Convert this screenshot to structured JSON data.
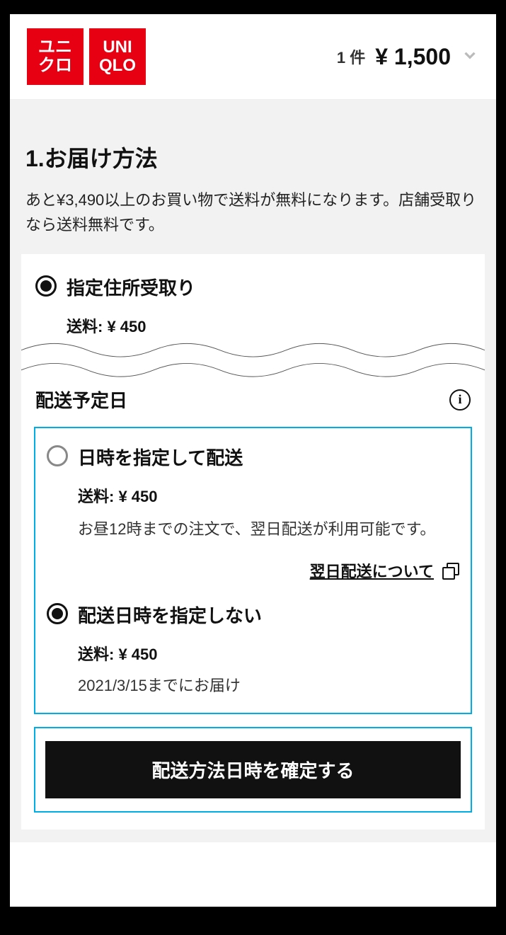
{
  "header": {
    "logo_jp_line1": "ユニ",
    "logo_jp_line2": "クロ",
    "logo_en_line1": "UNI",
    "logo_en_line2": "QLO",
    "cart_count": "1 件",
    "cart_price": "¥ 1,500"
  },
  "page": {
    "title": "1.お届け方法",
    "subtitle": "あと¥3,490以上のお買い物で送料が無料になります。店舗受取りなら送料無料です。"
  },
  "delivery_method": {
    "option1": {
      "title": "指定住所受取り",
      "shipping": "送料: ¥ 450"
    }
  },
  "schedule": {
    "section_title": "配送予定日",
    "option_scheduled": {
      "title": "日時を指定して配送",
      "shipping": "送料: ¥ 450",
      "desc": "お昼12時までの注文で、翌日配送が利用可能です。",
      "link": "翌日配送について"
    },
    "option_unscheduled": {
      "title": "配送日時を指定しない",
      "shipping": "送料: ¥ 450",
      "delivery_by": "2021/3/15までにお届け"
    }
  },
  "confirm_button": "配送方法日時を確定する"
}
